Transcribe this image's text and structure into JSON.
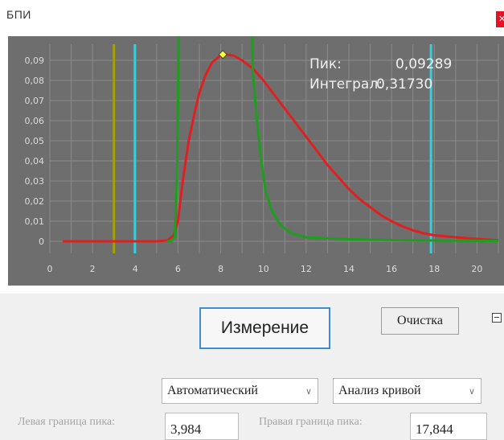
{
  "window": {
    "title": "БПИ",
    "close_icon": "close-icon"
  },
  "chart_data": {
    "type": "line",
    "x_ticks": [
      "0",
      "2",
      "4",
      "6",
      "8",
      "10",
      "12",
      "14",
      "16",
      "18",
      "20"
    ],
    "y_ticks": [
      "0",
      "0,01",
      "0,02",
      "0,03",
      "0,04",
      "0,05",
      "0,06",
      "0,07",
      "0,08",
      "0,09"
    ],
    "xlim": [
      0,
      21
    ],
    "ylim": [
      -0.006,
      0.098
    ],
    "grid": true,
    "colors": {
      "background": "#6e6e6e",
      "grid": "#8a8a8a",
      "tick_text": "#dcdcdc",
      "info_text": "#f0f0f0",
      "red_curve": "#e02020",
      "green_curve": "#1f9d1f",
      "cyan_marker": "#33d0e0",
      "olive_marker": "#a5a000",
      "peak_marker": "#ffff33"
    },
    "series": [
      {
        "color": "red",
        "points": [
          [
            0.6,
            0
          ],
          [
            5.0,
            0
          ],
          [
            5.5,
            0.0005
          ],
          [
            5.8,
            0.003
          ],
          [
            6.0,
            0.01
          ],
          [
            6.2,
            0.028
          ],
          [
            6.5,
            0.05
          ],
          [
            6.8,
            0.065
          ],
          [
            7.0,
            0.074
          ],
          [
            7.3,
            0.083
          ],
          [
            7.6,
            0.089
          ],
          [
            8.0,
            0.0925
          ],
          [
            8.2,
            0.0929
          ],
          [
            8.6,
            0.0924
          ],
          [
            9.0,
            0.09
          ],
          [
            9.5,
            0.086
          ],
          [
            10.0,
            0.08
          ],
          [
            10.5,
            0.073
          ],
          [
            11.0,
            0.066
          ],
          [
            11.5,
            0.059
          ],
          [
            12.0,
            0.052
          ],
          [
            12.5,
            0.045
          ],
          [
            13.0,
            0.038
          ],
          [
            13.5,
            0.032
          ],
          [
            14.0,
            0.026
          ],
          [
            14.5,
            0.021
          ],
          [
            15.0,
            0.017
          ],
          [
            15.5,
            0.013
          ],
          [
            16.0,
            0.01
          ],
          [
            16.5,
            0.0075
          ],
          [
            17.0,
            0.0055
          ],
          [
            17.5,
            0.004
          ],
          [
            18.0,
            0.003
          ],
          [
            19.0,
            0.002
          ],
          [
            20.0,
            0.0012
          ],
          [
            21.0,
            0.0005
          ]
        ]
      },
      {
        "color": "green",
        "points": [
          [
            5.5,
            0
          ],
          [
            5.7,
            0.0003
          ],
          [
            5.85,
            0.002
          ],
          [
            5.95,
            0.03
          ],
          [
            6.0,
            0.07
          ],
          [
            6.05,
            0.12
          ],
          [
            9.45,
            0.12
          ],
          [
            9.5,
            0.085
          ],
          [
            9.7,
            0.06
          ],
          [
            9.9,
            0.04
          ],
          [
            10.1,
            0.025
          ],
          [
            10.4,
            0.015
          ],
          [
            10.8,
            0.008
          ],
          [
            11.3,
            0.004
          ],
          [
            12.0,
            0.002
          ],
          [
            14.0,
            0.001
          ],
          [
            17.0,
            0.0005
          ],
          [
            21.0,
            0.0002
          ]
        ]
      }
    ],
    "vertical_markers": [
      {
        "color": "olive",
        "x": 3.0
      },
      {
        "color": "cyan",
        "x": 3.984
      },
      {
        "color": "cyan",
        "x": 17.844
      }
    ],
    "peak_point": {
      "x": 8.1,
      "y": 0.09289
    },
    "info": [
      {
        "label": "Пик:",
        "value": "0,09289"
      },
      {
        "label": "Интеграл:",
        "value": "0,31730"
      }
    ]
  },
  "controls": {
    "measure_label": "Измерение",
    "clear_label": "Очистка",
    "collapse_icon": "minus-box-icon",
    "mode_select": "Автоматический",
    "analysis_select": "Анализ кривой",
    "left_bound_label": "Левая граница пика:",
    "left_bound_value": "3,984",
    "right_bound_label": "Правая граница пика:",
    "right_bound_value": "17,844"
  }
}
